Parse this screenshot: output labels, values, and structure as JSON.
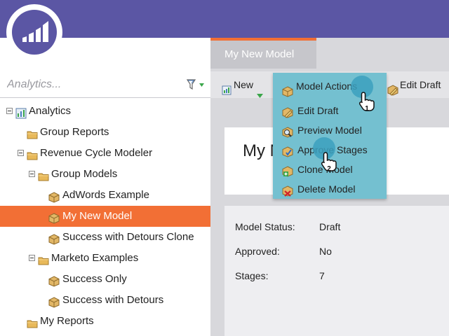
{
  "colors": {
    "brand_purple": "#5b56a4",
    "selected_orange": "#f26f35",
    "menu_teal": "#74c0d0"
  },
  "sidebar": {
    "search_placeholder": "Analytics...",
    "tree": [
      {
        "label": "Analytics",
        "icon": "analytics-icon"
      },
      {
        "label": "Group Reports",
        "icon": "folder-icon"
      },
      {
        "label": "Revenue Cycle Modeler",
        "icon": "folder-icon"
      },
      {
        "label": "Group Models",
        "icon": "folder-icon"
      },
      {
        "label": "AdWords Example",
        "icon": "model-icon"
      },
      {
        "label": "My New Model",
        "icon": "model-icon",
        "selected": true
      },
      {
        "label": "Success with Detours Clone",
        "icon": "model-icon"
      },
      {
        "label": "Marketo Examples",
        "icon": "folder-icon"
      },
      {
        "label": "Success Only",
        "icon": "model-icon"
      },
      {
        "label": "Success with Detours",
        "icon": "model-icon"
      },
      {
        "label": "My Reports",
        "icon": "folder-icon"
      }
    ]
  },
  "main": {
    "tab_label": "My New Model",
    "toolbar": {
      "new_label": "New",
      "model_actions_label": "Model Actions",
      "edit_draft_label": "Edit Draft"
    },
    "title": "My N",
    "details": {
      "status_label": "Model Status:",
      "status_value": "Draft",
      "approved_label": "Approved:",
      "approved_value": "No",
      "stages_label": "Stages:",
      "stages_value": "7"
    }
  },
  "menu": {
    "items": [
      {
        "label": "Edit Draft",
        "icon": "edit-draft-icon"
      },
      {
        "label": "Preview Model",
        "icon": "preview-icon"
      },
      {
        "label": "Approve Stages",
        "icon": "approve-icon"
      },
      {
        "label": "Clone Model",
        "icon": "clone-icon"
      },
      {
        "label": "Delete Model",
        "icon": "delete-icon"
      }
    ]
  },
  "callouts": {
    "step1": "1",
    "step2": "2"
  }
}
